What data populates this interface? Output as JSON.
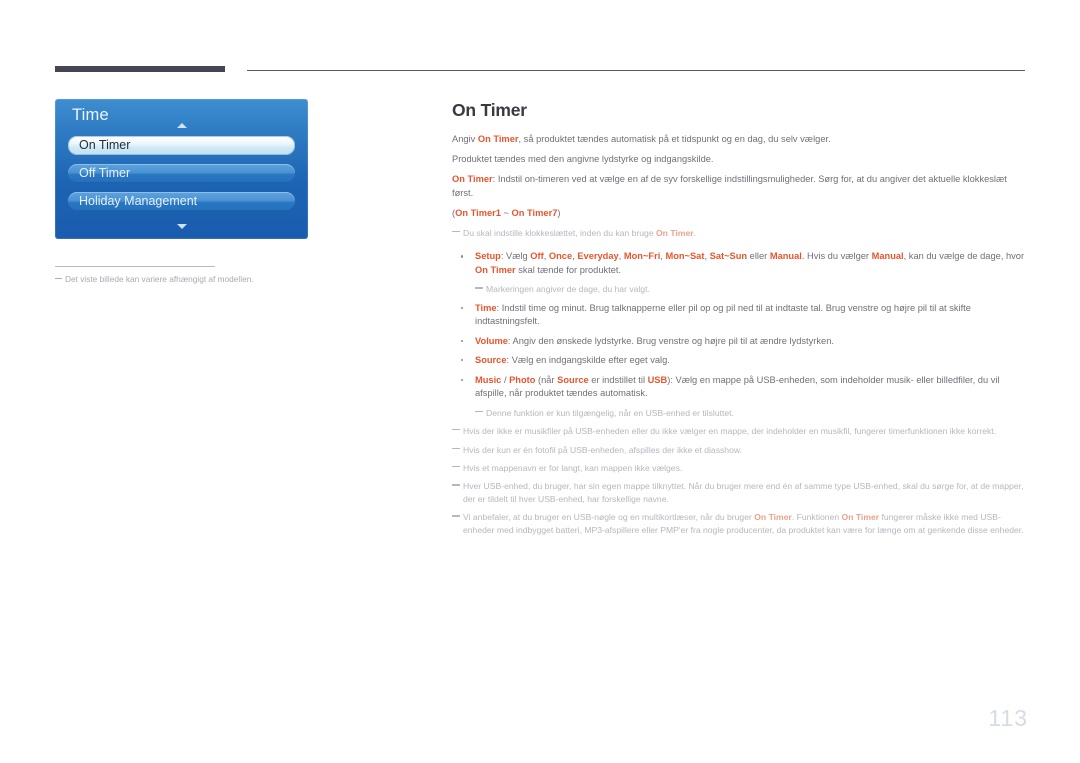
{
  "page": {
    "number": "113",
    "accent_orange": "#e8552d",
    "menu_blue": "#1d64b4",
    "body_gray": "#6f6f78",
    "note_gray": "#b6b6bf"
  },
  "osd_menu": {
    "title": "Time",
    "items": [
      {
        "label": "On Timer",
        "selected": true
      },
      {
        "label": "Off Timer",
        "selected": false
      },
      {
        "label": "Holiday Management",
        "selected": false
      }
    ],
    "scroll_up_icon": "caret-up-icon",
    "scroll_down_icon": "caret-down-icon"
  },
  "figure_caption": {
    "text": "Det viste billede kan variere afhængigt af modellen."
  },
  "content": {
    "title": "On Timer",
    "p1_a": "Angiv ",
    "p1_b": "On Timer",
    "p1_c": ", så produktet tændes automatisk på et tidspunkt og en dag, du selv vælger.",
    "p2": "Produktet tændes med den angivne lydstyrke og indgangskilde.",
    "p3_a": "On Timer",
    "p3_b": ": Indstil on-timeren ved at vælge en af de syv forskellige indstillingsmuligheder. Sørg for, at du angiver det aktuelle klokkeslæt først.",
    "p4_open": "(",
    "p4_a": "On Timer1",
    "p4_mid": " ~ ",
    "p4_b": "On Timer7",
    "p4_close": ")",
    "note1_a": "Du skal indstille klokkeslættet, inden du kan bruge ",
    "note1_b": "On Timer",
    "note1_c": ".",
    "b_setup_label": "Setup",
    "b_setup_1": ": Vælg ",
    "b_setup_off": "Off",
    "b_setup_s1": ", ",
    "b_setup_once": "Once",
    "b_setup_s2": ", ",
    "b_setup_everyday": "Everyday",
    "b_setup_s3": ", ",
    "b_setup_monfri": "Mon~Fri",
    "b_setup_s4": ", ",
    "b_setup_monsat": "Mon~Sat",
    "b_setup_s5": ", ",
    "b_setup_satsun": "Sat~Sun",
    "b_setup_2": " eller ",
    "b_setup_manual1": "Manual",
    "b_setup_3": ". Hvis du vælger ",
    "b_setup_manual2": "Manual",
    "b_setup_4": ", kan du vælge de dage, hvor ",
    "b_setup_ontimer": "On Timer",
    "b_setup_5": " skal tænde for produktet.",
    "note2": "Markeringen angiver de dage, du har valgt.",
    "b_time_label": "Time",
    "b_time_text": ": Indstil time og minut. Brug talknapperne eller pil op og pil ned til at indtaste tal. Brug venstre og højre pil til at skifte indtastningsfelt.",
    "b_volume_label": "Volume",
    "b_volume_text": ": Angiv den ønskede lydstyrke. Brug venstre og højre pil til at ændre lydstyrken.",
    "b_source_label": "Source",
    "b_source_text": ": Vælg en indgangskilde efter eget valg.",
    "b_music_label": "Music",
    "b_music_sep": " / ",
    "b_photo_label": "Photo",
    "b_music_1": " (når ",
    "b_music_source": "Source",
    "b_music_2": " er indstillet til ",
    "b_music_usb": "USB",
    "b_music_3": "): Vælg en mappe på USB-enheden, som indeholder musik- eller billedfiler, du vil afspille, når produktet tændes automatisk.",
    "note3": "Denne funktion er kun tilgængelig, når en USB-enhed er tilsluttet.",
    "note4": "Hvis der ikke er musikfiler på USB-enheden eller du ikke vælger en mappe, der indeholder en musikfil, fungerer timerfunktionen ikke korrekt.",
    "note5": "Hvis der kun er én fotofil på USB-enheden, afspilles der ikke et diasshow.",
    "note6": "Hvis et mappenavn er for langt, kan mappen ikke vælges.",
    "note7": "Hver USB-enhed, du bruger, har sin egen mappe tilknyttet. Når du bruger mere end én af samme type USB-enhed, skal du sørge for, at de mapper, der er tildelt til hver USB-enhed, har forskellige navne.",
    "note8_a": "Vi anbefaler, at du bruger en USB-nøgle og en multikortlæser, når du bruger ",
    "note8_b": "On Timer",
    "note8_c": ". Funktionen ",
    "note8_d": "On Timer",
    "note8_e": " fungerer måske ikke med USB-enheder med indbygget batteri, MP3-afspillere eller PMP'er fra nogle producenter, da produktet kan være for længe om at genkende disse enheder."
  }
}
